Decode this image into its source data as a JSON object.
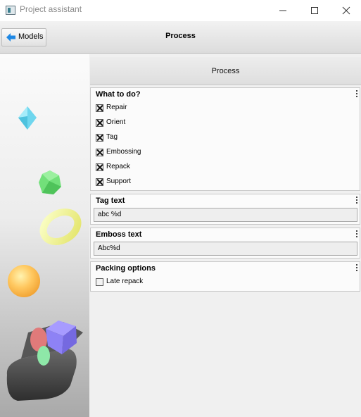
{
  "window": {
    "title": "Project assistant",
    "icon": "app-icon",
    "controls": [
      "minimize-icon",
      "maximize-icon",
      "close-icon"
    ]
  },
  "toolbar": {
    "back_label": "Models",
    "back_icon": "arrow-left-icon",
    "title": "Process",
    "accent_color": "#1e88e5"
  },
  "main": {
    "section_title": "Process",
    "groups": {
      "what_to_do": {
        "title": "What to do?",
        "options": [
          {
            "label": "Repair",
            "checked": true
          },
          {
            "label": "Orient",
            "checked": true
          },
          {
            "label": "Tag",
            "checked": true
          },
          {
            "label": "Embossing",
            "checked": true
          },
          {
            "label": "Repack",
            "checked": true
          },
          {
            "label": "Support",
            "checked": true
          }
        ]
      },
      "tag_text": {
        "title": "Tag text",
        "value": "abc %d"
      },
      "emboss_text": {
        "title": "Emboss text",
        "value": "Abc%d"
      },
      "packing": {
        "title": "Packing options",
        "options": [
          {
            "label": "Late repack",
            "checked": false
          }
        ]
      }
    }
  }
}
